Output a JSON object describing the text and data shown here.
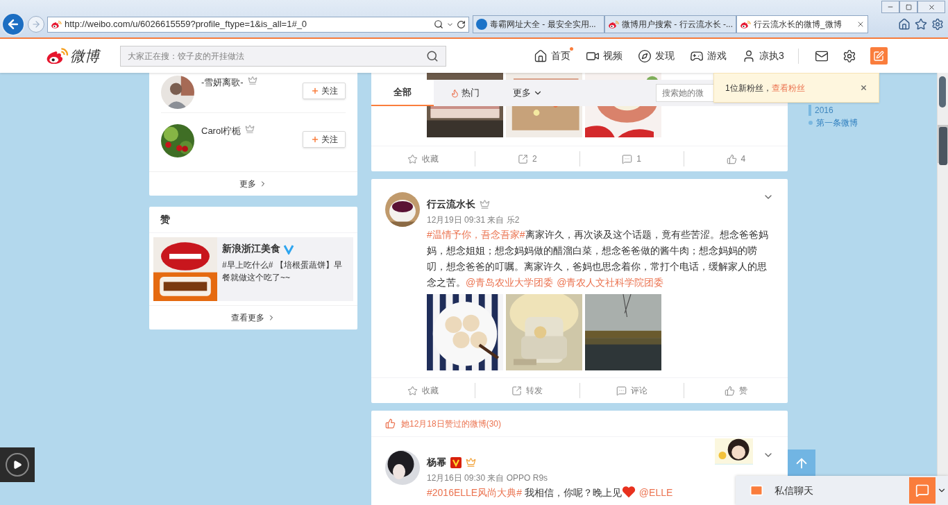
{
  "browser": {
    "url": "http://weibo.com/u/6026615559?profile_ftype=1&is_all=1#_0",
    "tabs": [
      {
        "title": "毒霸网址大全 - 最安全实用...",
        "kind": "k",
        "selected": false
      },
      {
        "title": "微博用户搜索 - 行云流水长 -...",
        "kind": "weibo",
        "selected": false
      },
      {
        "title": "行云流水长的微博_微博",
        "kind": "weibo",
        "selected": true
      }
    ]
  },
  "nav": {
    "logo_text": "微博",
    "search": {
      "placeholder": "大家正在搜：饺子皮的开挂做法"
    },
    "items": [
      {
        "label": "首页",
        "kind": "home",
        "dot": true
      },
      {
        "label": "视频",
        "kind": "video",
        "dot": false
      },
      {
        "label": "发现",
        "kind": "discover",
        "dot": false
      },
      {
        "label": "游戏",
        "kind": "game",
        "dot": false
      },
      {
        "label": "凉执3",
        "kind": "user",
        "dot": false
      }
    ]
  },
  "follow_card": {
    "users": [
      {
        "name": "-雪妍离歌-",
        "button": "关注"
      },
      {
        "name": "Carol柠栀",
        "button": "关注"
      }
    ],
    "more": "更多"
  },
  "like_card": {
    "title": "赞",
    "item": {
      "name": "新浪浙江美食",
      "verified": true,
      "text": "#早上吃什么# 【培根蛋蔬饼】早餐就做这个吃了~~"
    },
    "more": "查看更多"
  },
  "feed_tabs": [
    {
      "label": "全部",
      "kind": "plain",
      "selected": true
    },
    {
      "label": "热门",
      "kind": "hot",
      "selected": false
    },
    {
      "label": "更多",
      "kind": "dropdown",
      "selected": false
    }
  ],
  "feed_search": {
    "placeholder": "搜索她的微"
  },
  "notification": {
    "text": "1位新粉丝，",
    "link": "查看粉丝"
  },
  "timeline": [
    {
      "label": "2016",
      "kind": "year"
    },
    {
      "label": "第一条微博",
      "kind": "entry"
    }
  ],
  "posts": [
    {
      "kind": "partial",
      "images": [
        {
          "kind": "picture"
        },
        {
          "kind": "picture"
        },
        {
          "kind": "picture"
        }
      ],
      "actions": [
        {
          "kind": "favorite",
          "label": "收藏"
        },
        {
          "kind": "repost",
          "label": "2"
        },
        {
          "kind": "comment",
          "label": "1"
        },
        {
          "kind": "like",
          "label": "4"
        }
      ]
    },
    {
      "kind": "full",
      "author": "行云流水长",
      "verified": false,
      "meta": "12月19日 09:31 来自 乐2",
      "segments": [
        {
          "kind": "topic",
          "text": "#温情予你，吾念吾家#"
        },
        {
          "kind": "plain",
          "text": "离家许久，再次谈及这个话题，竟有些苦涩。想念爸爸妈妈，想念姐姐；想念妈妈做的醋溜白菜，想念爸爸做的酱牛肉；想念妈妈的唠叨，想念爸爸的叮嘱。离家许久，爸妈也思念着你，常打个电话，缓解家人的思念之苦。"
        },
        {
          "kind": "mention",
          "text": "@青岛农业大学团委"
        },
        {
          "kind": "mention",
          "text": "@青农人文社科学院团委"
        }
      ],
      "images": [
        {
          "kind": "picture"
        },
        {
          "kind": "picture"
        },
        {
          "kind": "picture"
        }
      ],
      "actions": [
        {
          "kind": "favorite",
          "label": "收藏"
        },
        {
          "kind": "repost",
          "label": "转发"
        },
        {
          "kind": "comment",
          "label": "评论"
        },
        {
          "kind": "like",
          "label": "赞"
        }
      ]
    },
    {
      "kind": "liked",
      "liked_header": "她12月18日赞过的微博(30)",
      "author": "杨幂",
      "verified": true,
      "meta": "12月16日 09:30 来自 OPPO R9s",
      "segments": [
        {
          "kind": "topic",
          "text": "#2016ELLE风尚大典#"
        },
        {
          "kind": "plain",
          "text": " 我相信，你呢？晚上见"
        },
        {
          "kind": "heart"
        },
        {
          "kind": "mention",
          "text": "@ELLE"
        }
      ]
    }
  ],
  "chat": {
    "label": "私信聊天"
  }
}
